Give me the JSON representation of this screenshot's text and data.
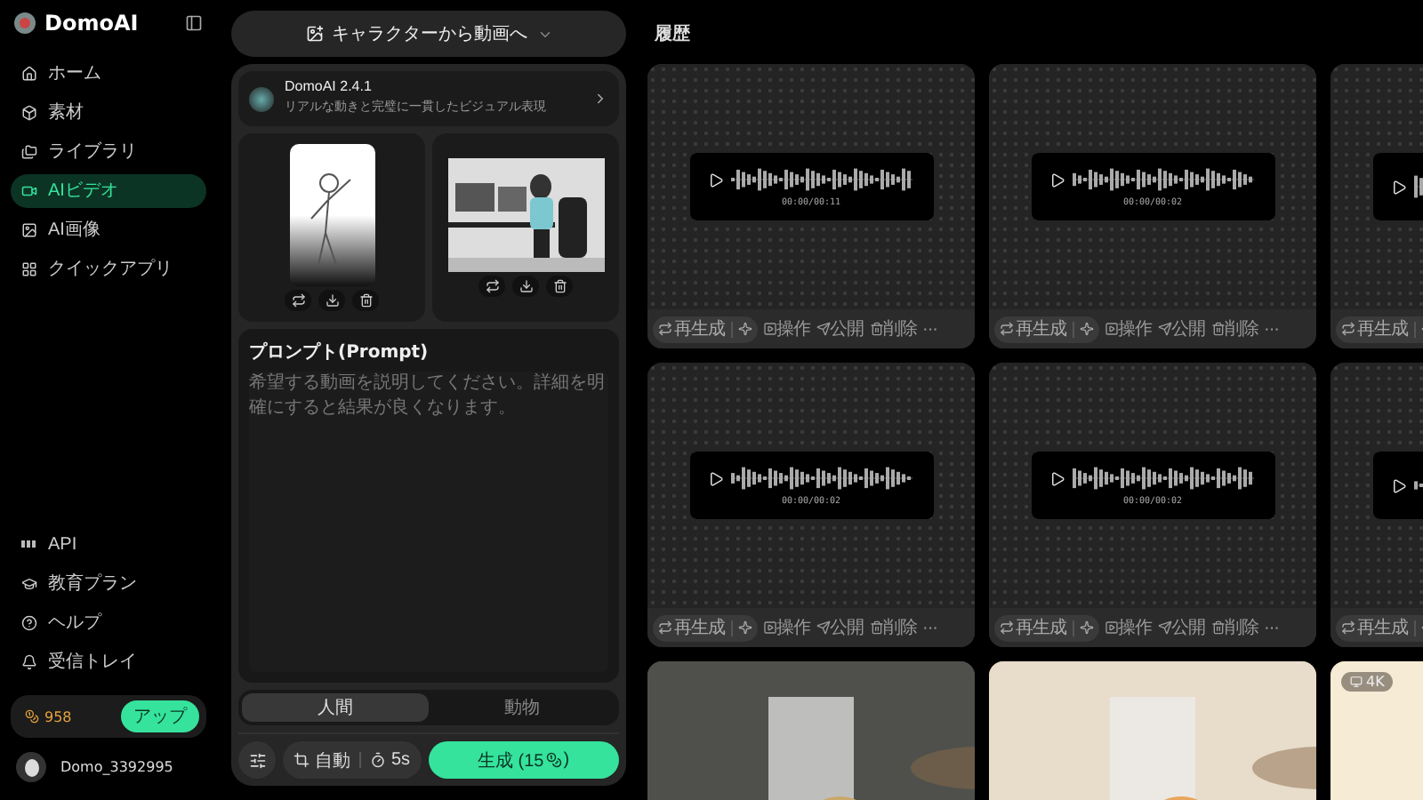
{
  "sidebar": {
    "brand": "DomoAI",
    "nav": [
      {
        "label": "ホーム",
        "selected": false
      },
      {
        "label": "素材",
        "selected": false
      },
      {
        "label": "ライブラリ",
        "selected": false
      },
      {
        "label": "AIビデオ",
        "selected": true
      },
      {
        "label": "AI画像",
        "selected": false
      },
      {
        "label": "クイックアプリ",
        "selected": false
      }
    ],
    "bottom": [
      "API",
      "教育プラン",
      "ヘルプ",
      "受信トレイ"
    ],
    "credits": "958",
    "upgrade": "アップ",
    "user": "Domo_3392995"
  },
  "panel": {
    "mode": "キャラクターから動画へ",
    "model": {
      "name": "DomoAI 2.4.1",
      "desc": "リアルな動きと完璧に一貫したビジュアル表現"
    },
    "prompt": {
      "title": "プロンプト(Prompt)",
      "placeholder": "希望する動画を説明してください。詳細を明確にすると結果が良くなります。"
    },
    "types": [
      {
        "label": "人間",
        "selected": true
      },
      {
        "label": "動物",
        "selected": false
      }
    ],
    "ratio": "自動",
    "duration": "5s",
    "generate": {
      "text": "生成 (15",
      "close": ")"
    }
  },
  "history": {
    "title": "履歴",
    "cards": [
      {
        "kind": "audio",
        "time": "00:00/00:11",
        "actions": [
          "再生成",
          "操作",
          "公開",
          "削除",
          "···"
        ]
      },
      {
        "kind": "audio",
        "time": "00:00/00:02",
        "actions": [
          "再生成",
          "操作",
          "公開",
          "削除",
          "···"
        ]
      },
      {
        "kind": "audio",
        "actions": [
          "再生成"
        ]
      },
      {
        "kind": "audio",
        "time": "00:00/00:02",
        "actions": [
          "再生成",
          "操作",
          "公開",
          "削除",
          "···"
        ]
      },
      {
        "kind": "audio",
        "time": "00:00/00:02",
        "actions": [
          "再生成",
          "操作",
          "公開",
          "削除",
          "···"
        ]
      },
      {
        "kind": "audio",
        "actions": [
          "再生成"
        ]
      },
      {
        "kind": "picture"
      },
      {
        "kind": "picture"
      },
      {
        "kind": "picture",
        "badge": "4K"
      }
    ]
  }
}
